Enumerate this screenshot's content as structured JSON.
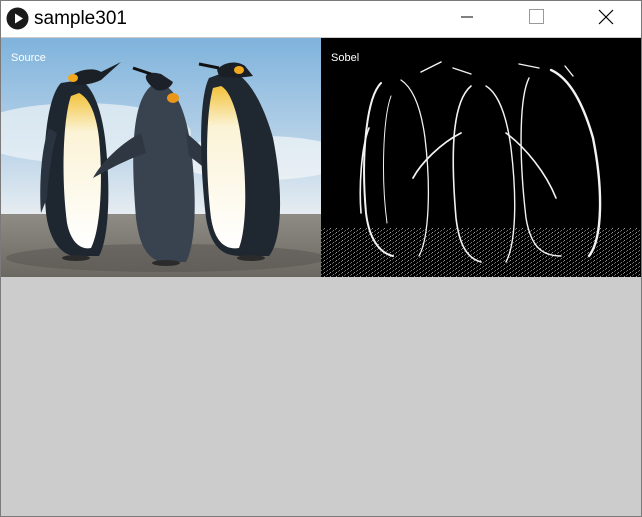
{
  "window": {
    "title": "sample301",
    "app_icon": "play-icon",
    "controls": {
      "minimize_icon": "minimize-icon",
      "maximize_icon": "maximize-icon",
      "close_icon": "close-icon"
    }
  },
  "panels": {
    "source": {
      "label": "Source"
    },
    "sobel": {
      "label": "Sobel"
    }
  },
  "colors": {
    "titlebar": "#ffffff",
    "canvas_background": "#cccccc",
    "sky": "#9dc4e4",
    "sobel_background": "#000000"
  }
}
